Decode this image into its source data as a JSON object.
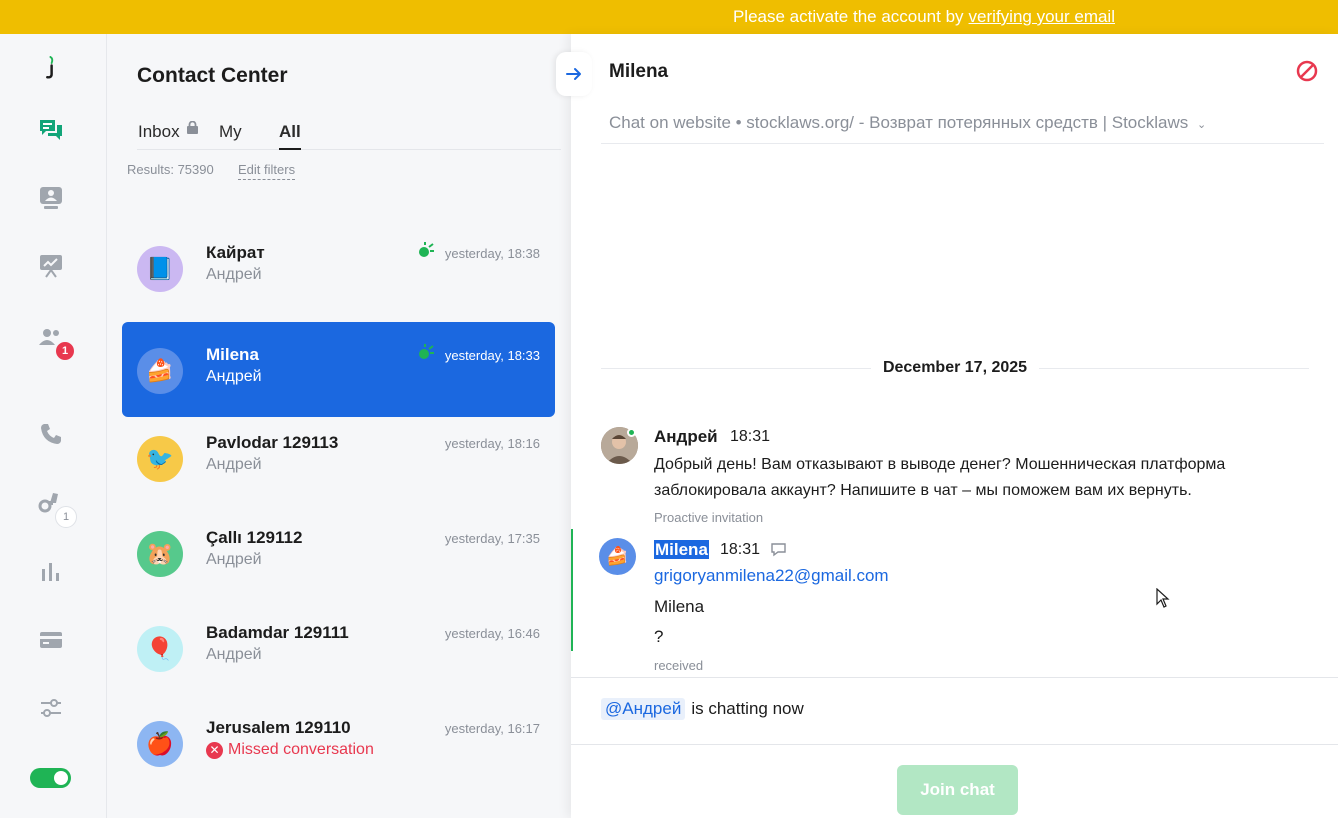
{
  "banner": {
    "text": "Please activate the account by",
    "link": "verifying your email",
    "color": "#efbe00"
  },
  "rail": {
    "logo": "jivo-logo",
    "items": [
      {
        "icon": "chat-bubbles-icon",
        "active": true
      },
      {
        "icon": "visitors-icon"
      },
      {
        "icon": "presentation-icon"
      },
      {
        "icon": "team-icon",
        "badge": "1"
      },
      {
        "icon": "phone-icon"
      },
      {
        "icon": "binoculars-icon",
        "badge": "1"
      },
      {
        "icon": "reports-icon"
      },
      {
        "icon": "billing-icon"
      },
      {
        "icon": "settings-sliders-icon"
      }
    ],
    "status_toggle_on": true
  },
  "list": {
    "title": "Contact Center",
    "tabs": [
      "Inbox",
      "My",
      "All"
    ],
    "active_tab": "All",
    "results": "Results: 75390",
    "edit_filters": "Edit filters",
    "contacts": [
      {
        "name": "Кайрат",
        "sub": "Андрей",
        "time": "yesterday, 18:38",
        "avatar": "📘",
        "avatar_bg": "#cbb8f2",
        "status_icon": true
      },
      {
        "name": "Milena",
        "sub": "Андрей",
        "time": "yesterday, 18:33",
        "avatar": "🍰",
        "avatar_bg": "#5a8ee8",
        "status_icon": true,
        "selected": true
      },
      {
        "name": "Pavlodar 129113",
        "sub": "Андрей",
        "time": "yesterday, 18:16",
        "avatar": "🐦",
        "avatar_bg": "#f7c948"
      },
      {
        "name": "Çallı 129112",
        "sub": "Андрей",
        "time": "yesterday, 17:35",
        "avatar": "🐹",
        "avatar_bg": "#56c98c"
      },
      {
        "name": "Badamdar 129111",
        "sub": "Андрей",
        "time": "yesterday, 16:46",
        "avatar": "🎈",
        "avatar_bg": "#bff0f5"
      },
      {
        "name": "Jerusalem 129110",
        "sub": "Missed conversation",
        "time": "yesterday, 16:17",
        "avatar": "🍎",
        "avatar_bg": "#8db6f2",
        "missed": true
      }
    ]
  },
  "chat": {
    "name": "Milena",
    "source": "Chat on website • stocklaws.org/ - Возврат потерянных средств | Stocklaws",
    "date": "December 17, 2025",
    "messages": [
      {
        "author": "Андрей",
        "time": "18:31",
        "text_line1": "Добрый день! Вам отказывают в выводе денег? Мошенническая платформа",
        "text_line2": "заблокировала аккаунт? Напишите в чат – мы поможем вам их вернуть.",
        "meta": "Proactive invitation"
      },
      {
        "author": "Milena",
        "time": "18:31",
        "email": "grigoryanmilena22@gmail.com",
        "line1": "Milena",
        "line2": "?",
        "meta": "received"
      }
    ],
    "mention": "@Андрей",
    "chatting_now": "is chatting now",
    "join_button": "Join chat"
  }
}
